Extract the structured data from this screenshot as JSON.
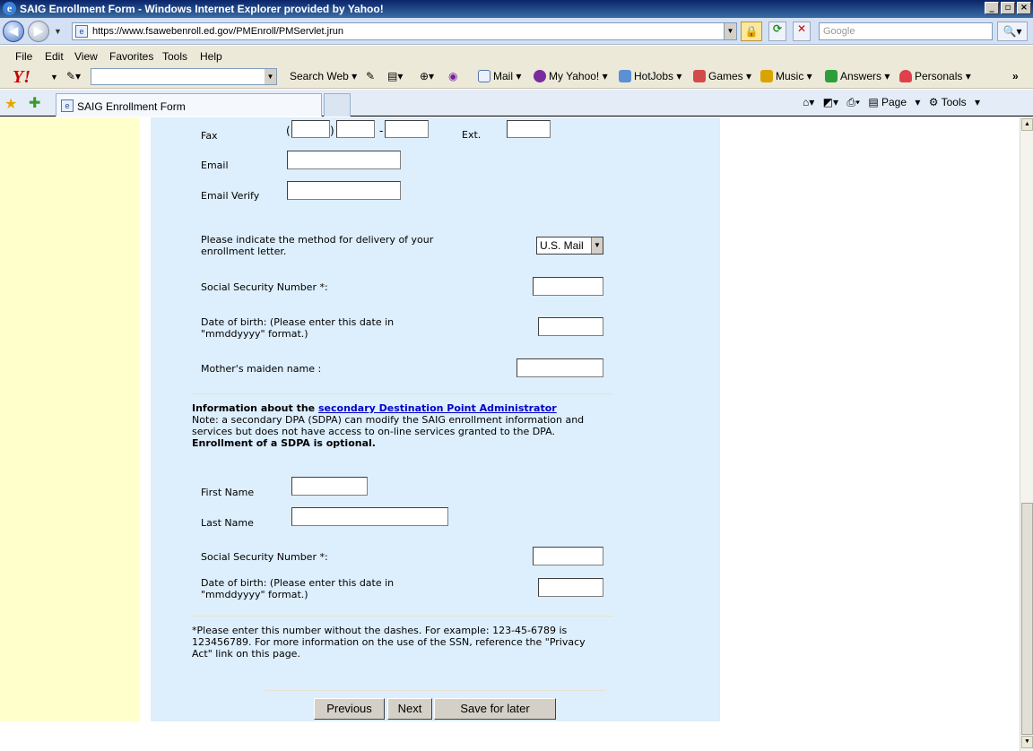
{
  "window": {
    "title": "SAIG Enrollment Form - Windows Internet Explorer provided by Yahoo!",
    "min_glyph": "_",
    "max_glyph": "▫",
    "close_glyph": "×"
  },
  "address": {
    "url": "https://www.fsawebenroll.ed.gov/PMEnroll/PMServlet.jrun",
    "search_placeholder": "Google"
  },
  "menu": [
    "File",
    "Edit",
    "View",
    "Favorites",
    "Tools",
    "Help"
  ],
  "yahoo_toolbar": {
    "search_web": "Search Web",
    "mail": "Mail",
    "my_yahoo": "My Yahoo!",
    "hotjobs": "HotJobs",
    "games": "Games",
    "music": "Music",
    "answers": "Answers",
    "personals": "Personals"
  },
  "tab": {
    "label": "SAIG Enrollment Form"
  },
  "command_bar": {
    "page": "Page",
    "tools": "Tools"
  },
  "form": {
    "fax_label": "Fax",
    "fax_open_paren": "(",
    "fax_close_paren": ")",
    "fax_dash": "-",
    "ext_label": "Ext.",
    "email_label": "Email",
    "email_verify_label": "Email Verify",
    "delivery_label_1": "Please indicate the method for delivery of your",
    "delivery_label_2": "enrollment letter.",
    "delivery_value": "U.S. Mail",
    "ssn_label": "Social Security Number *:",
    "dob_label_1": "Date of birth: (Please enter this date in",
    "dob_label_2": "\"mmddyyyy\" format.)",
    "maiden_label": "Mother's maiden name :",
    "sdpa": {
      "heading_prefix": "Information about the ",
      "heading_link": "secondary Destination Point Administrator",
      "note_1": "Note: a secondary DPA (SDPA) can modify the SAIG enrollment information and",
      "note_2": "services but does not have access to on-line services granted to the DPA.",
      "optional": "Enrollment of a SDPA is optional.",
      "first_name_label": "First Name",
      "last_name_label": "Last Name",
      "ssn_label": "Social Security Number *:",
      "dob_label_1": "Date of birth: (Please enter this date in",
      "dob_label_2": "\"mmddyyyy\" format.)"
    },
    "footnote_1": "*Please enter this number without the dashes. For example: 123-45-6789 is",
    "footnote_2": "123456789. For more information on the use of the SSN, reference the \"Privacy",
    "footnote_3": "Act\" link on this page.",
    "buttons": {
      "previous": "Previous",
      "next": "Next",
      "save": "Save for later"
    }
  }
}
